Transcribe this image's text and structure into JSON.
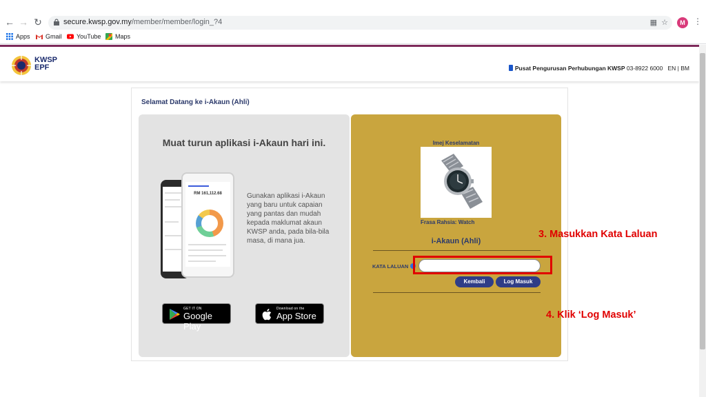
{
  "browser": {
    "url_domain": "secure.kwsp.gov.my",
    "url_path": "/member/member/login_?4",
    "avatar_letter": "M",
    "bookmarks": [
      {
        "label": "Apps",
        "icon": "apps-grid-icon"
      },
      {
        "label": "Gmail",
        "icon": "gmail-icon"
      },
      {
        "label": "YouTube",
        "icon": "youtube-icon"
      },
      {
        "label": "Maps",
        "icon": "maps-icon"
      }
    ]
  },
  "header": {
    "logo_line1": "KWSP",
    "logo_line2": "EPF",
    "helpline_label": "Pusat Pengurusan Perhubungan KWSP",
    "helpline_number": "03-8922 6000",
    "lang_en": "EN",
    "lang_sep": "|",
    "lang_bm": "BM"
  },
  "card": {
    "welcome": "Selamat Datang ke i-Akaun (Ahli)",
    "left": {
      "title": "Muat turun aplikasi i-Akaun hari ini.",
      "description": "Gunakan aplikasi i-Akaun yang baru untuk capaian yang pantas dan mudah kepada maklumat akaun KWSP anda, pada bila-bila masa, di mana jua.",
      "phone_amount": "RM 161,112.68",
      "google_play_small": "GET IT ON",
      "google_play_big": "Google Play",
      "app_store_small": "Download on the",
      "app_store_big": "App Store"
    },
    "right": {
      "image_label": "Imej Keselamatan",
      "phrase": "Frasa Rahsia: Watch",
      "section_title": "i-Akaun (Ahli)",
      "password_label": "KATA LALUAN",
      "password_value": "",
      "back_button": "Kembali",
      "login_button": "Log Masuk"
    }
  },
  "annotations": {
    "step3": "3. Masukkan Kata Laluan",
    "step4": "4. Klik ‘Log Masuk’"
  },
  "colors": {
    "gold_panel": "#c9a53e",
    "navy": "#2c3a6b",
    "button": "#2f3d87",
    "annotation_red": "#e00000",
    "accent_bar": "#7d2a5a"
  }
}
